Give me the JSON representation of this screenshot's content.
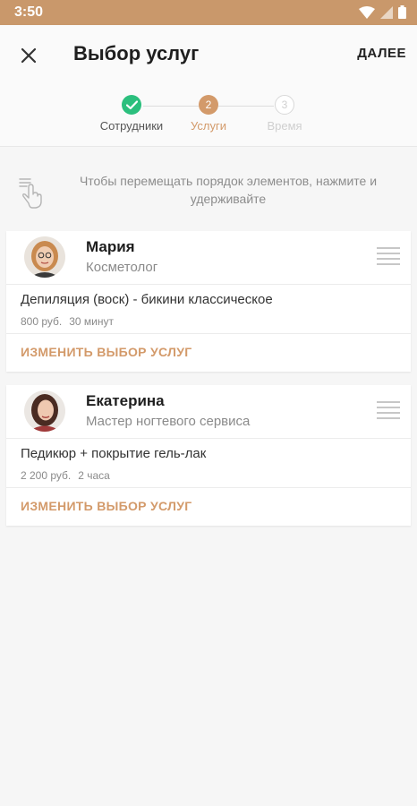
{
  "status_bar": {
    "time": "3:50",
    "background": "#c9986b"
  },
  "app_bar": {
    "title": "Выбор услуг",
    "next_label": "ДАЛЕЕ",
    "close_icon": "close-icon"
  },
  "stepper": {
    "steps": [
      {
        "label": "Сотрудники",
        "marker": "✓",
        "state": "done",
        "color": "#2bbf7d"
      },
      {
        "label": "Услуги",
        "marker": "2",
        "state": "active",
        "color": "#d39a6a"
      },
      {
        "label": "Время",
        "marker": "3",
        "state": "inactive",
        "color": "#d8d8d8"
      }
    ]
  },
  "hint": {
    "text": "Чтобы перемещать порядок элементов, нажмите и удерживайте",
    "icon": "touch-hold-icon"
  },
  "employees": [
    {
      "name": "Мария",
      "role": "Косметолог",
      "service": {
        "name": "Депиляция (воск) - бикини классическое",
        "price": "800 руб.",
        "duration": "30 минут"
      },
      "change_label": "ИЗМЕНИТЬ ВЫБОР УСЛУГ"
    },
    {
      "name": "Екатерина",
      "role": "Мастер ногтевого сервиса",
      "service": {
        "name": "Педикюр + покрытие гель-лак",
        "price": "2 200 руб.",
        "duration": "2 часа"
      },
      "change_label": "ИЗМЕНИТЬ ВЫБОР УСЛУГ"
    }
  ],
  "colors": {
    "accent": "#d39a6a",
    "success": "#2bbf7d",
    "muted_text": "#8a8a8a",
    "background": "#f6f6f6"
  }
}
